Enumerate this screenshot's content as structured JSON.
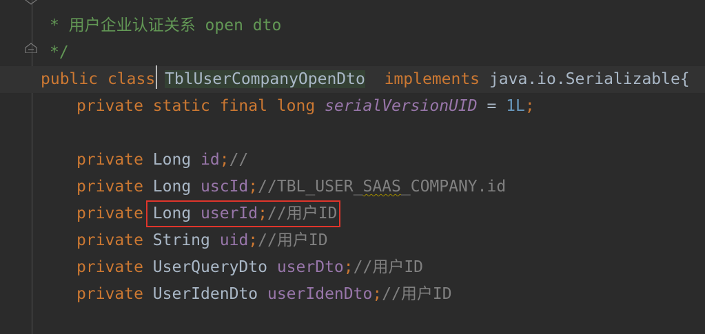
{
  "comment": {
    "line1": "* 用户企业认证关系 open dto",
    "line2": "*/"
  },
  "class_decl": {
    "kw_public": "public",
    "kw_class": "class",
    "name": "TblUserCompanyOpenDto",
    "kw_implements": "implements",
    "iface": "java.io.Serializable",
    "brace": "{"
  },
  "serial": {
    "mods": "private static final long",
    "name": "serialVersionUID",
    "eq": " = ",
    "value": "1L",
    "semi": ";"
  },
  "fields": [
    {
      "mod": "private",
      "type": "Long",
      "name": "id",
      "semi": ";",
      "comment": "//"
    },
    {
      "mod": "private",
      "type": "Long",
      "name": "uscId",
      "semi": ";",
      "comment_pre": "//TBL_USER_",
      "comment_sq": "SAAS",
      "comment_post": "_COMPANY.id"
    },
    {
      "mod": "private",
      "type": "Long",
      "name": "userId",
      "semi": ";",
      "comment": "//用户ID"
    },
    {
      "mod": "private",
      "type": "String",
      "name": "uid",
      "semi": ";",
      "comment": "//用户ID"
    },
    {
      "mod": "private",
      "type": "UserQueryDto",
      "name": "userDto",
      "semi": ";",
      "comment": "//用户ID"
    },
    {
      "mod": "private",
      "type": "UserIdenDto",
      "name": "userIdenDto",
      "semi": ";",
      "comment": "//用户ID"
    }
  ],
  "colors": {
    "background": "#2b2b2b",
    "keyword": "#cc7832",
    "doc_comment": "#629755",
    "line_comment": "#808080",
    "field": "#9876aa",
    "number": "#6897bb",
    "highlight_box": "#e0352b"
  }
}
